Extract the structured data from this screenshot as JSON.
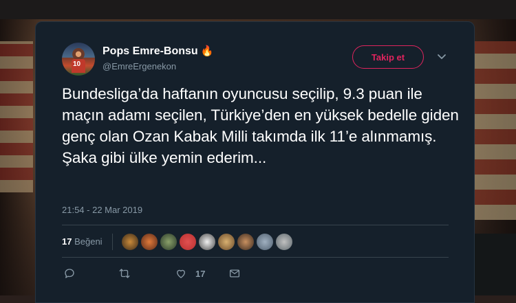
{
  "tweet": {
    "author_name": "Pops Emre-Bonsu",
    "author_badge_icon": "fire-icon",
    "author_handle": "@EmreErgenekon",
    "follow_label": "Takip et",
    "text": "Bundesliga’da haftanın oyuncusu seçilip, 9.3 puan ile maçın adamı seçilen, Türkiye’den en yüksek bedelle giden genç olan Ozan Kabak Milli takımda ilk 11’e alınmamış. Şaka gibi ülke yemin ederim...",
    "timestamp": "21:54 - 22 Mar 2019",
    "likes_count": "17",
    "likes_label": "Beğeni",
    "like_action_count": "17"
  },
  "colors": {
    "card_bg": "#15202b",
    "follow_accent": "#e0245e",
    "muted_text": "#8899a6"
  }
}
